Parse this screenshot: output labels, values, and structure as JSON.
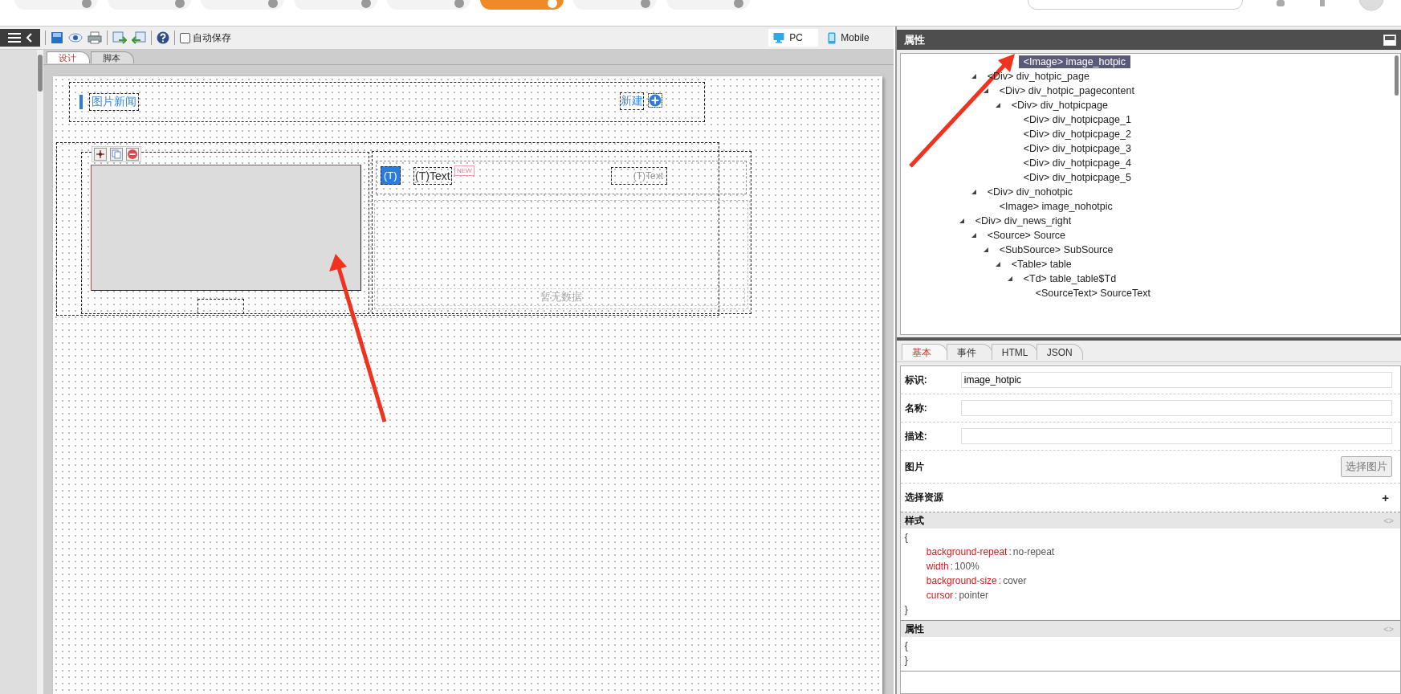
{
  "top_tabs": [
    {
      "selected": false
    },
    {
      "selected": false
    },
    {
      "selected": false
    },
    {
      "selected": false
    },
    {
      "selected": false
    },
    {
      "selected": true
    },
    {
      "selected": false
    },
    {
      "selected": false
    }
  ],
  "toolbar": {
    "autosave": {
      "label": "自动保存",
      "checked": false
    },
    "devices": [
      {
        "label": "PC",
        "kind": "desktop",
        "selected": true
      },
      {
        "label": "Mobile",
        "kind": "phone",
        "selected": false
      }
    ]
  },
  "editor_tabs": [
    {
      "label": "设计",
      "selected": true
    },
    {
      "label": "脚本",
      "selected": false
    }
  ],
  "canvas": {
    "header_title": "图片新闻",
    "new_button": "新建",
    "image": {
      "selected": true
    },
    "row_texts": [
      {
        "text": "(T)",
        "kind": "tag"
      },
      {
        "text": "(T)Text",
        "kind": "title"
      },
      {
        "text": "NEW",
        "kind": "badge"
      },
      {
        "text": "(T)Text",
        "kind": "date"
      }
    ],
    "empty_text": "暂无数据"
  },
  "panel": {
    "title": "属性",
    "tree": [
      {
        "children": [
          {
            "children": [
              {
                "children": [
                  {
                    "children": [
                      {
                        "label": "<Image> image_hotpic",
                        "selected": true
                      }
                    ]
                  }
                ]
              }
            ]
          },
          {
            "label": "<Div> div_hotpic_page",
            "selected": false,
            "expanded": true,
            "children": [
              {
                "label": "<Div> div_hotpic_pagecontent",
                "selected": false,
                "expanded": true,
                "children": [
                  {
                    "label": "<Div> div_hotpicpage",
                    "selected": false,
                    "expanded": true,
                    "children": [
                      {
                        "label": "<Div> div_hotpicpage_1",
                        "selected": false
                      },
                      {
                        "label": "<Div> div_hotpicpage_2",
                        "selected": false
                      },
                      {
                        "label": "<Div> div_hotpicpage_3",
                        "selected": false
                      },
                      {
                        "label": "<Div> div_hotpicpage_4",
                        "selected": false
                      },
                      {
                        "label": "<Div> div_hotpicpage_5",
                        "selected": false
                      }
                    ]
                  }
                ]
              }
            ]
          },
          {
            "label": "<Div> div_nohotpic",
            "selected": false,
            "expanded": true,
            "children": [
              {
                "label": "<Image> image_nohotpic",
                "selected": false
              }
            ]
          }
        ]
      },
      {
        "label": "<Div> div_news_right",
        "selected": false,
        "expanded": true,
        "children": [
          {
            "label": "<Source> Source",
            "selected": false,
            "expanded": true,
            "children": [
              {
                "label": "<SubSource> SubSource",
                "selected": false,
                "expanded": true,
                "children": [
                  {
                    "label": "<Table> table",
                    "selected": false,
                    "expanded": true,
                    "children": [
                      {
                        "label": "<Td> table_table$Td",
                        "selected": false,
                        "expanded": true,
                        "children": [
                          {
                            "label": "<SourceText> SourceText",
                            "selected": false
                          }
                        ]
                      }
                    ]
                  }
                ]
              }
            ]
          }
        ]
      }
    ],
    "prop_tabs": [
      {
        "label": "基本",
        "selected": true
      },
      {
        "label": "事件",
        "selected": false
      },
      {
        "label": "HTML",
        "selected": false
      },
      {
        "label": "JSON",
        "selected": false
      }
    ],
    "fields": [
      {
        "kind": "input",
        "label": "标识:",
        "value": "image_hotpic"
      },
      {
        "kind": "input",
        "label": "名称:"
      },
      {
        "kind": "input",
        "label": "描述:"
      },
      {
        "kind": "button",
        "label": "图片",
        "button": "选择图片"
      },
      {
        "kind": "add",
        "label": "选择资源",
        "action": "+"
      }
    ],
    "sections": [
      {
        "title": "样式",
        "toggle": "<>",
        "open": "{",
        "rules": [
          {
            "property": "background-repeat",
            "colon": ":",
            "value": "no-repeat"
          },
          {
            "property": "width",
            "colon": ":",
            "value": "100%"
          },
          {
            "property": "background-size",
            "colon": ":",
            "value": "cover"
          },
          {
            "property": "cursor",
            "colon": ":",
            "value": "pointer"
          }
        ],
        "close": "}"
      },
      {
        "title": "属性",
        "toggle": "<>",
        "open": "{",
        "close": "}"
      }
    ]
  }
}
